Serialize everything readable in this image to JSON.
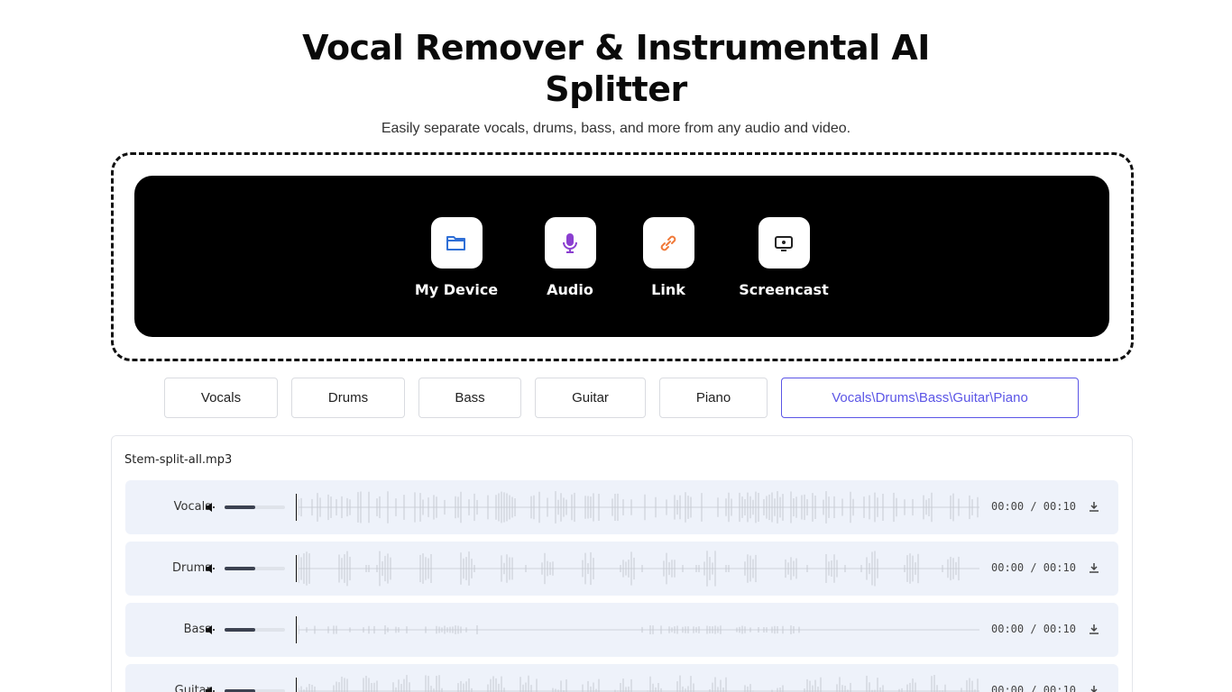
{
  "header": {
    "title_line1": "Vocal Remover & Instrumental AI",
    "title_line2": "Splitter",
    "subtitle": "Easily separate vocals, drums, bass, and more from any audio and video."
  },
  "sources": [
    {
      "label": "My Device",
      "icon": "folder-icon",
      "color": "#2f6fd6"
    },
    {
      "label": "Audio",
      "icon": "microphone-icon",
      "color": "#8b3fd0"
    },
    {
      "label": "Link",
      "icon": "link-icon",
      "color": "#f07a3a"
    },
    {
      "label": "Screencast",
      "icon": "screen-icon",
      "color": "#222222"
    }
  ],
  "stem_tabs": [
    {
      "label": "Vocals"
    },
    {
      "label": "Drums"
    },
    {
      "label": "Bass"
    },
    {
      "label": "Guitar"
    },
    {
      "label": "Piano"
    },
    {
      "label": "Vocals\\Drums\\Bass\\Guitar\\Piano",
      "active": true
    }
  ],
  "result": {
    "filename": "Stem-split-all.mp3",
    "tracks": [
      {
        "name": "Vocals",
        "time": "00:00 / 00:10",
        "volume": 0.5
      },
      {
        "name": "Drums",
        "time": "00:00 / 00:10",
        "volume": 0.5
      },
      {
        "name": "Bass",
        "time": "00:00 / 00:10",
        "volume": 0.5
      },
      {
        "name": "Guitar",
        "time": "00:00 / 00:10",
        "volume": 0.5
      }
    ]
  },
  "colors": {
    "accent": "#5b55e6",
    "track_bg": "#eef2fa",
    "dropzone_bg": "#000000"
  }
}
